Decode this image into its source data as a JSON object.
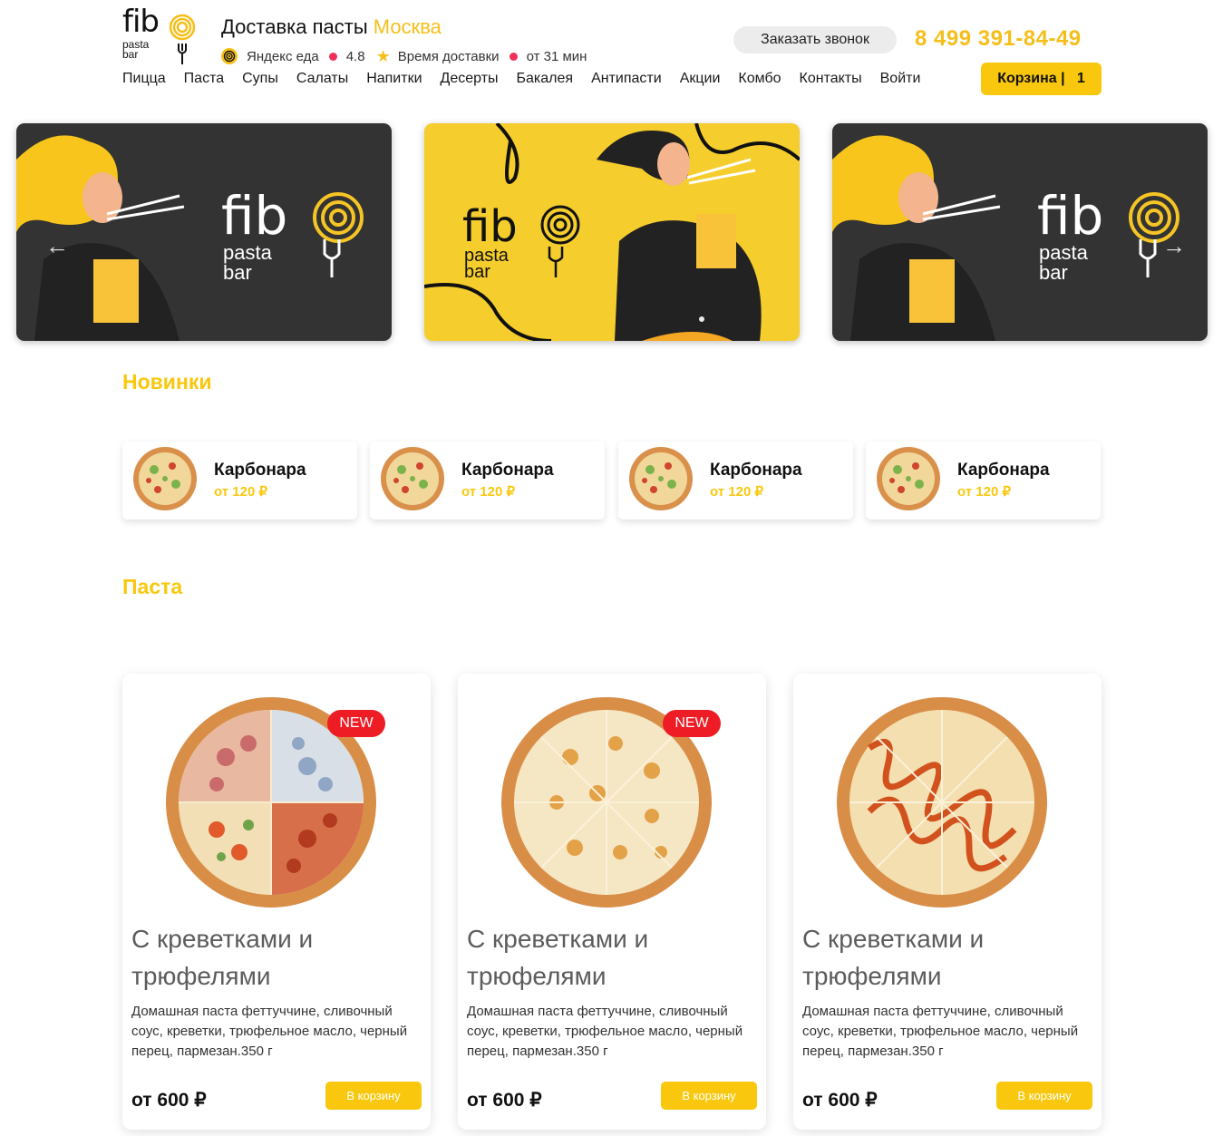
{
  "header": {
    "logo": {
      "word": "fib",
      "sub_line1": "pasta",
      "sub_line2": "bar"
    },
    "headline": {
      "prefix": "Доставка пасты",
      "city": "Москва"
    },
    "info": {
      "service": "Яндекс еда",
      "rating": "4.8",
      "delivery_label": "Время доставки",
      "delivery_time": "от 31 мин"
    },
    "call_button": "Заказать звонок",
    "phone": "8 499 391-84-49",
    "cart": {
      "label": "Корзина |",
      "count": "1"
    }
  },
  "nav": [
    "Пицца",
    "Паста",
    "Супы",
    "Салаты",
    "Напитки",
    "Десерты",
    "Бакалея",
    "Антипасти",
    "Акции",
    "Комбо",
    "Контакты",
    "Войти"
  ],
  "banners": [
    {
      "theme": "dark",
      "brand_word": "fib",
      "brand_sub1": "pasta",
      "brand_sub2": "bar"
    },
    {
      "theme": "yellow",
      "brand_word": "fib",
      "brand_sub1": "pasta",
      "brand_sub2": "bar"
    },
    {
      "theme": "dark",
      "brand_word": "fib",
      "brand_sub1": "pasta",
      "brand_sub2": "bar"
    }
  ],
  "slider": {
    "prev_icon": "arrow-left-icon",
    "next_icon": "arrow-right-icon",
    "prev_glyph": "←",
    "next_glyph": "→"
  },
  "novelties": {
    "title": "Новинки",
    "items": [
      {
        "name": "Карбонара",
        "price": "от 120 ₽"
      },
      {
        "name": "Карбонара",
        "price": "от 120 ₽"
      },
      {
        "name": "Карбонара",
        "price": "от 120 ₽"
      },
      {
        "name": "Карбонара",
        "price": "от 120 ₽"
      }
    ]
  },
  "pasta": {
    "title": "Паста",
    "items": [
      {
        "badge": "NEW",
        "title": "С креветками и трюфелями",
        "description": "Домашная паста феттуччине, сливочный соус, креветки, трюфельное масло, черный перец, пармезан.350 г",
        "price": "от 600 ₽",
        "button": "В корзину"
      },
      {
        "badge": "NEW",
        "title": "С креветками и трюфелями",
        "description": "Домашная паста феттуччине, сливочный соус, креветки, трюфельное масло, черный перец, пармезан.350 г",
        "price": "от 600 ₽",
        "button": "В корзину"
      },
      {
        "badge": "",
        "title": "С креветками и трюфелями",
        "description": "Домашная паста феттуччине, сливочный соус, креветки, трюфельное масло, черный перец, пармезан.350 г",
        "price": "от 600 ₽",
        "button": "В корзину"
      }
    ]
  },
  "colors": {
    "accent": "#f9c80e",
    "badge": "#ee1c25",
    "dot": "#f0305a",
    "banner_dark": "#333333",
    "banner_yellow": "#f5cd2c"
  }
}
